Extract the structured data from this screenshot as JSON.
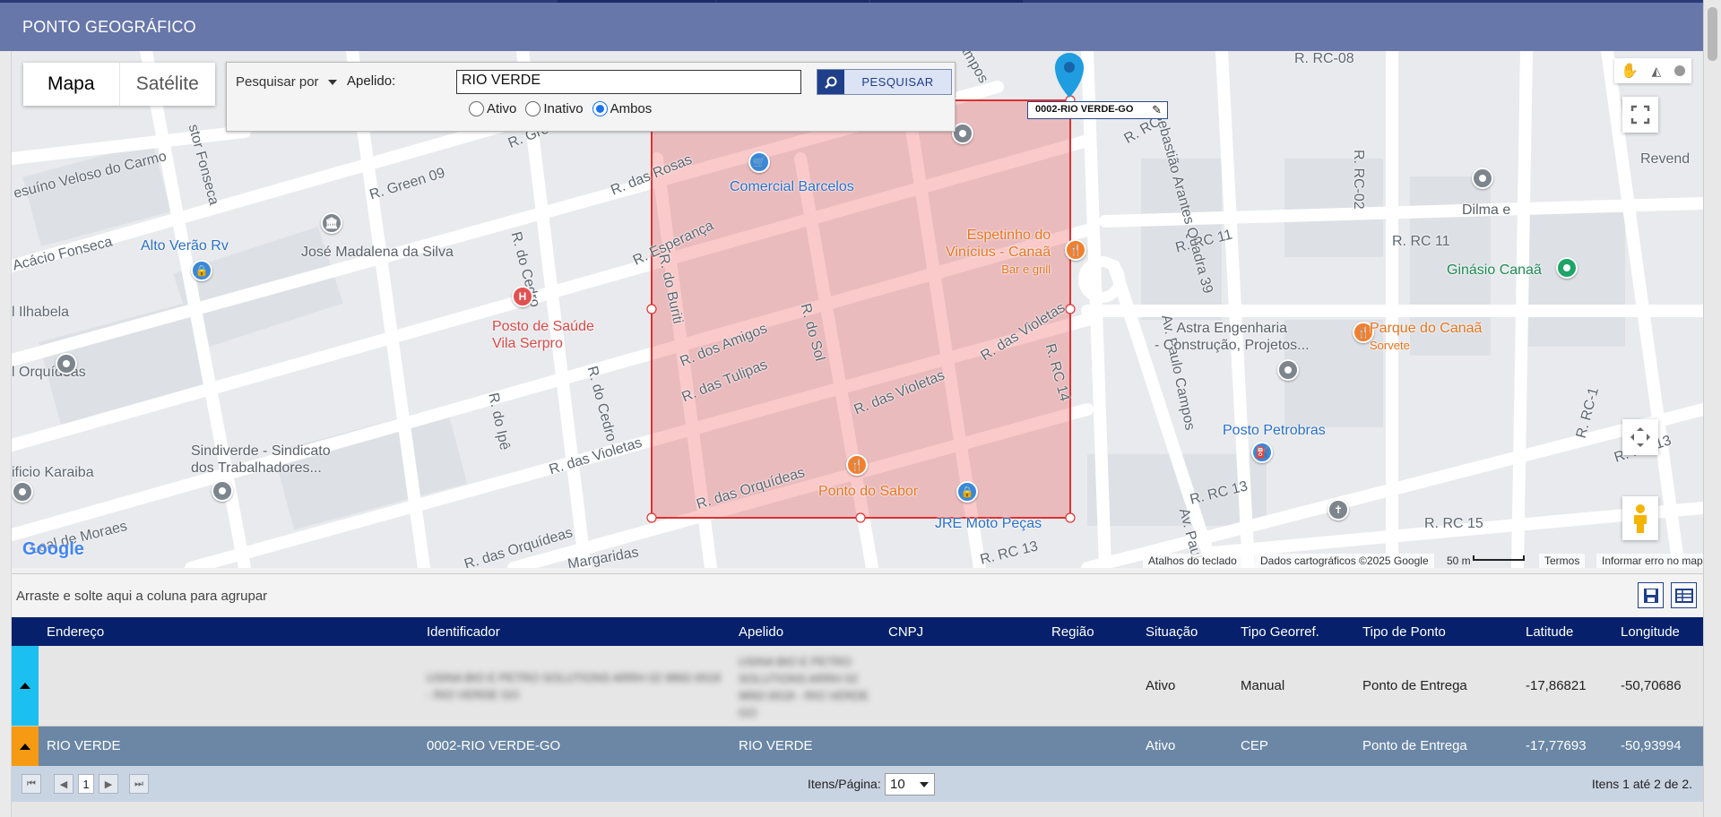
{
  "header": {
    "title": "PONTO GEOGRÁFICO"
  },
  "map": {
    "maptype": {
      "map": "Mapa",
      "satellite": "Satélite"
    },
    "search": {
      "search_by_label": "Pesquisar por",
      "apelido_label": "Apelido:",
      "apelido_value": "RIO VERDE",
      "search_button": "PESQUISAR",
      "status_options": [
        "Ativo",
        "Inativo",
        "Ambos"
      ],
      "status_selected": "Ambos"
    },
    "marker_label": "0002-RIO VERDE-GO",
    "streets": [
      "R. RC-08",
      "R. RC-02",
      "R. RC 11",
      "R. RC 11",
      "R. RC 13",
      "R. RC 13",
      "R. RC 15",
      "R. RC-1",
      "R. RC 13",
      "R. Green 09",
      "R. das Rosas",
      "R. Esperança",
      "R. do Cedro",
      "R. do Cedro",
      "R. do Buriti",
      "R. dos Amigos",
      "R. do Sol",
      "R. das Tulipas",
      "R. das Violetas",
      "R. das Violetas",
      "R. das Violetas",
      "R. RC 14",
      "R. das Orquídeas",
      "R. das Orquídeas",
      "R. do Ipê",
      "Av. Paulo Campos",
      "Sebastião Arantes Quadra 39",
      "R. RC",
      "Margaridas",
      "Campos",
      "Av. Paul",
      "esuíno Veloso do Carmo",
      "stor Fonseca",
      "Acácio Fonseca",
      "l Ilhabela",
      "l Orquídeas",
      "ificio Karaiba",
      "Leal de Moraes",
      "R. Gree",
      "Revend"
    ],
    "pois": {
      "comercial_barcelos": "Comercial Barcelos",
      "espetinho": "Espetinho do\nVinícius - Canaã",
      "espetinho_sub": "Bar e grill",
      "alto_verao": "Alto Verão Rv",
      "jose_madalena": "José Madalena da Silva",
      "posto_saude": "Posto de Saúde\nVila Serpro",
      "ginasio": "Ginásio Canaã",
      "dilma": "Dilma e",
      "parque": "Parque do Canaã",
      "parque_sub": "Sorvete",
      "astra": "Astra Engenharia\n- Construção, Projetos...",
      "posto_petrobras": "Posto Petrobras",
      "sindiverde": "Sindiverde - Sindicato\ndos Trabalhadores...",
      "ponto_sabor": "Ponto do Sabor",
      "jre": "JRE Moto Peças"
    },
    "attribution": {
      "shortcuts": "Atalhos do teclado",
      "data": "Dados cartográficos ©2025 Google",
      "scale": "50 m",
      "terms": "Termos",
      "report": "Informar erro no mapa",
      "logo": "Google"
    }
  },
  "group_bar": {
    "text": "Arraste e solte aqui a coluna para agrupar"
  },
  "table": {
    "columns": [
      "Endereço",
      "Identificador",
      "Apelido",
      "CNPJ",
      "Região",
      "Situação",
      "Tipo Georref.",
      "Tipo de Ponto",
      "Latitude",
      "Longitude"
    ],
    "rows": [
      {
        "endereco": "",
        "identificador": "USINA BIO E PETRO SOLUTIONS ARRH 02 9892-0018 - RIO VERDE GO",
        "apelido": "USINA BIO E PETRO SOLUTIONS ARRH 02 9892-0018 - RIO VERDE GO",
        "cnpj": "",
        "regiao": "",
        "situacao": "Ativo",
        "tipo_georref": "Manual",
        "tipo_ponto": "Ponto de Entrega",
        "latitude": "-17,86821",
        "longitude": "-50,70686"
      },
      {
        "endereco": "RIO VERDE",
        "identificador": "0002-RIO VERDE-GO",
        "apelido": "RIO VERDE",
        "cnpj": "",
        "regiao": "",
        "situacao": "Ativo",
        "tipo_georref": "CEP",
        "tipo_ponto": "Ponto de Entrega",
        "latitude": "-17,77693",
        "longitude": "-50,93994"
      }
    ]
  },
  "pager": {
    "current_page": "1",
    "items_label": "Itens/Página:",
    "items_per_page": "10",
    "summary": "Itens 1 até 2 de 2."
  }
}
